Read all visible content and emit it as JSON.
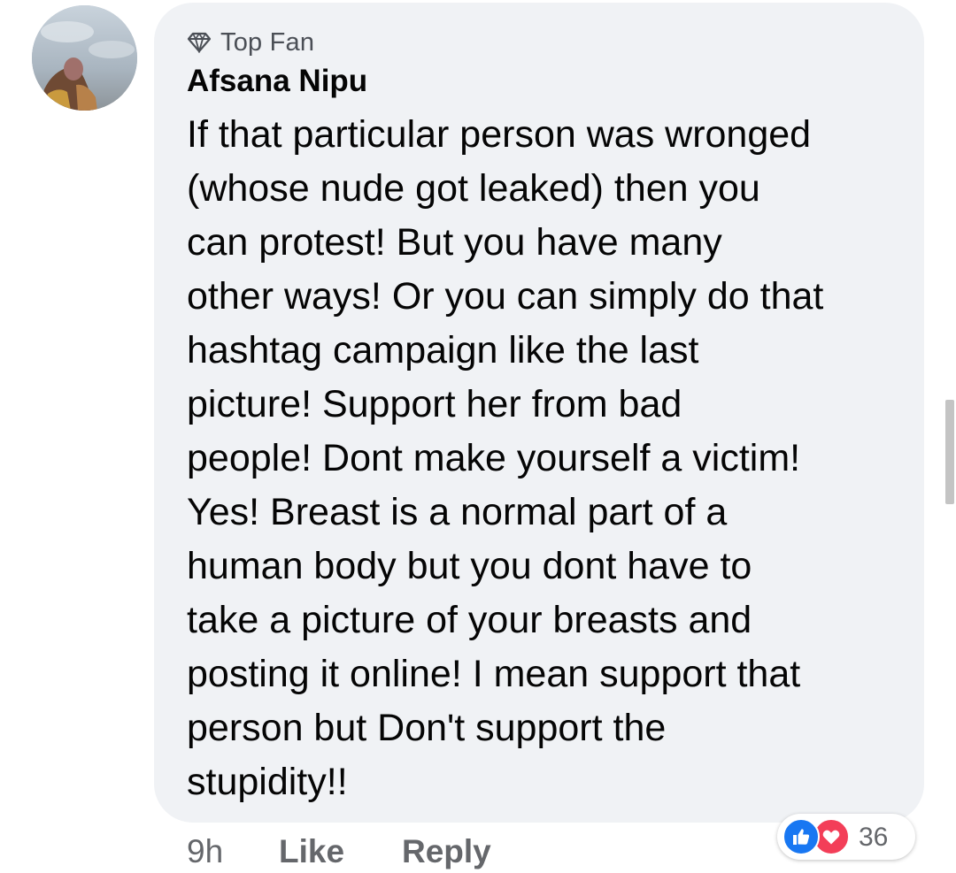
{
  "comment": {
    "badge": {
      "icon": "diamond-icon",
      "label": "Top Fan"
    },
    "author": "Afsana Nipu",
    "text_lines": [
      "If that particular person was wronged",
      "(whose nude got leaked) then you",
      "can protest!  But you have many",
      "other ways! Or you can simply do that",
      "hashtag campaign like the last",
      "picture!  Support her from bad",
      "people! Dont make yourself a victim!",
      "Yes! Breast is a normal part of a",
      "human body but you dont have to",
      "take a picture of your breasts and",
      "posting it online! I mean support that",
      "person but Don't support the",
      "stupidity!!"
    ],
    "time": "9h",
    "like_label": "Like",
    "reply_label": "Reply",
    "reactions": {
      "icons": [
        "like-reaction-icon",
        "love-reaction-icon"
      ],
      "count": "36",
      "colors": {
        "like": "#1877f2",
        "love": "#f33e58"
      }
    }
  },
  "colors": {
    "bubble": "#f0f2f5",
    "text": "#050505",
    "secondary_text": "#65676b"
  }
}
